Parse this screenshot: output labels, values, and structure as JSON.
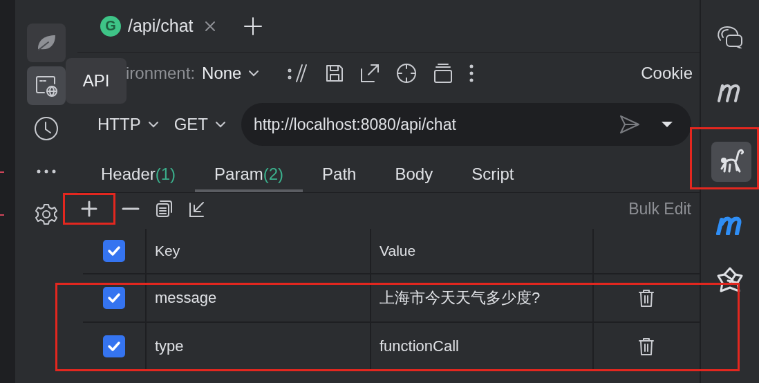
{
  "tabs": [
    {
      "label": "/api/chat",
      "selected": true,
      "badge": "G"
    }
  ],
  "sidebar": {
    "items": [
      {
        "kind": "leaf",
        "selected": false
      },
      {
        "kind": "api",
        "selected": true
      },
      {
        "kind": "clock",
        "selected": false
      },
      {
        "kind": "more",
        "selected": false
      },
      {
        "kind": "gear",
        "selected": false
      }
    ],
    "tooltip": "API"
  },
  "environment": {
    "label": "ironment:",
    "value": "None"
  },
  "toolbar_right": "Cookie",
  "request": {
    "protocol": "HTTP",
    "method": "GET",
    "url": "http://localhost:8080/api/chat"
  },
  "request_tabs": [
    {
      "label": "Header",
      "count": "(1)",
      "selected": false
    },
    {
      "label": "Param",
      "count": "(2)",
      "selected": true
    },
    {
      "label": "Path",
      "selected": false
    },
    {
      "label": "Body",
      "selected": false
    },
    {
      "label": "Script",
      "selected": false
    }
  ],
  "param_tools": [
    {
      "kind": "add",
      "annotated": true
    },
    {
      "kind": "remove",
      "annotated": false
    },
    {
      "kind": "copy",
      "annotated": false
    },
    {
      "kind": "import",
      "annotated": false
    }
  ],
  "bulk_edit": "Bulk Edit",
  "table": {
    "all_checked": true,
    "columns": [
      "Key",
      "Value"
    ],
    "rows_annotated": true,
    "rows": [
      {
        "checked": true,
        "key": "message",
        "value": "上海市今天天气多少度?"
      },
      {
        "checked": true,
        "key": "type",
        "value": "functionCall"
      }
    ]
  },
  "right_bar": [
    {
      "kind": "chat",
      "annotated": false,
      "selected": false
    },
    {
      "kind": "m",
      "annotated": false,
      "selected": false
    },
    {
      "kind": "monkey",
      "annotated": true,
      "selected": true
    },
    {
      "kind": "blue-m",
      "annotated": false,
      "selected": false
    },
    {
      "kind": "star",
      "annotated": false,
      "selected": false
    }
  ]
}
